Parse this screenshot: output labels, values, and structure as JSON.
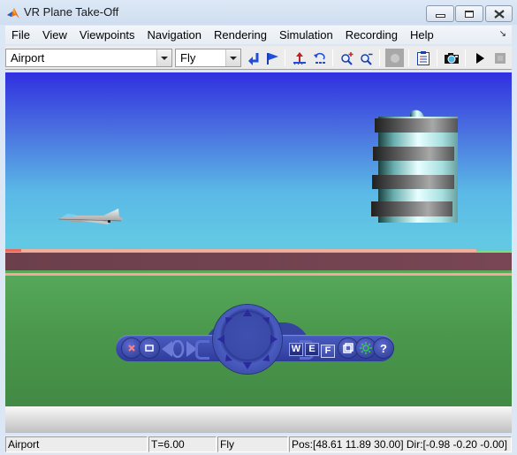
{
  "window": {
    "title": "VR Plane Take-Off",
    "app_icon": "matlab-icon",
    "controls": {
      "minimize": "minimize-icon",
      "maximize": "maximize-icon",
      "close": "close-icon"
    }
  },
  "menu": {
    "items": [
      "File",
      "View",
      "Viewpoints",
      "Navigation",
      "Rendering",
      "Simulation",
      "Recording",
      "Help"
    ],
    "undock_icon": "undock-arrow-icon"
  },
  "toolbar": {
    "viewpoint_select": {
      "value": "Airport"
    },
    "navigation_select": {
      "value": "Fly"
    },
    "buttons": [
      {
        "name": "return-to-viewpoint",
        "icon": "return-arrow-icon"
      },
      {
        "name": "create-viewpoint",
        "icon": "flag-icon"
      },
      {
        "name": "straighten-up",
        "icon": "straighten-up-icon"
      },
      {
        "name": "undo-move",
        "icon": "undo-move-icon"
      },
      {
        "name": "zoom-in",
        "icon": "zoom-in-icon"
      },
      {
        "name": "zoom-out",
        "icon": "zoom-out-icon"
      },
      {
        "name": "record",
        "icon": "record-icon",
        "enabled": false
      },
      {
        "name": "capture-frame-list",
        "icon": "clipboard-icon"
      },
      {
        "name": "snapshot",
        "icon": "camera-icon"
      },
      {
        "name": "start-simulation",
        "icon": "play-icon"
      },
      {
        "name": "stop-simulation",
        "icon": "stop-icon",
        "enabled": false
      }
    ]
  },
  "scene": {
    "objects": [
      "sky",
      "ground",
      "runway",
      "plane",
      "control-tower"
    ],
    "colors": {
      "sky_top": "#3030e0",
      "sky_horizon": "#62c8e4",
      "grass": "#7ae07e",
      "runway": "#74434f",
      "runway_edge": "#f4a898"
    }
  },
  "nav_panel": {
    "keys": [
      {
        "label": "W",
        "active": false
      },
      {
        "label": "E",
        "active": false
      },
      {
        "label": "F",
        "active": true
      }
    ],
    "help_label": "?",
    "buttons": [
      "close-panel",
      "minimize-panel",
      "slide-left",
      "slide-right",
      "rotate-wheel",
      "views",
      "headlight",
      "help"
    ]
  },
  "status": {
    "viewpoint": "Airport",
    "time": "T=6.00",
    "mode": "Fly",
    "position": "Pos:[48.61 11.89 30.00] Dir:[-0.98 -0.20 -0.00]"
  }
}
